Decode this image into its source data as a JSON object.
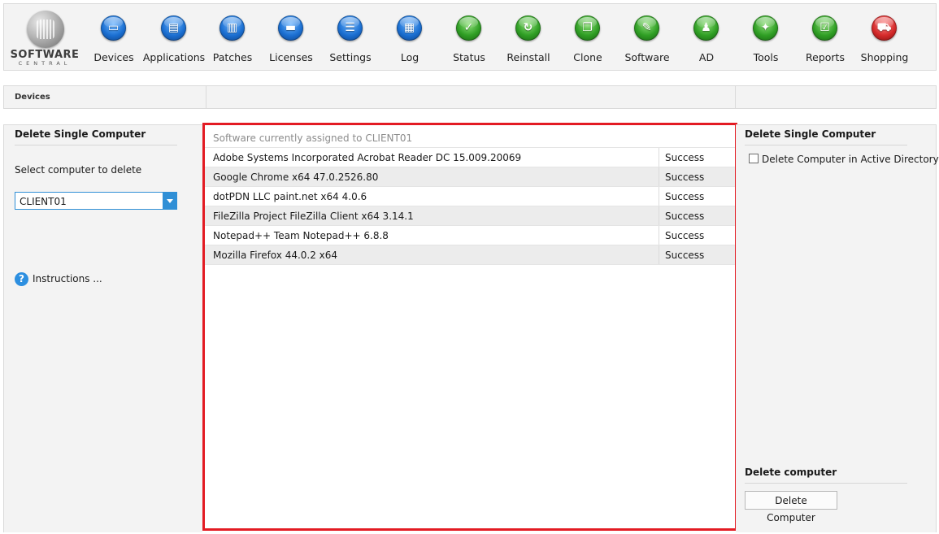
{
  "logo": {
    "word": "SOFTWARE",
    "sub": "CENTRAL"
  },
  "toolbar": {
    "items": [
      {
        "label": "Devices",
        "glyph": "▭",
        "icon": "monitor-icon",
        "color": "blue"
      },
      {
        "label": "Applications",
        "glyph": "▤",
        "icon": "applications-icon",
        "color": "blue"
      },
      {
        "label": "Patches",
        "glyph": "▥",
        "icon": "patches-icon",
        "color": "blue"
      },
      {
        "label": "Licenses",
        "glyph": "▬",
        "icon": "folder-icon",
        "color": "blue"
      },
      {
        "label": "Settings",
        "glyph": "☰",
        "icon": "settings-list-icon",
        "color": "blue"
      },
      {
        "label": "Log",
        "glyph": "▦",
        "icon": "log-book-icon",
        "color": "blue"
      },
      {
        "label": "Status",
        "glyph": "✓",
        "icon": "checkmark-icon",
        "color": "green"
      },
      {
        "label": "Reinstall",
        "glyph": "↻",
        "icon": "refresh-icon",
        "color": "green"
      },
      {
        "label": "Clone",
        "glyph": "❐",
        "icon": "clone-icon",
        "color": "green"
      },
      {
        "label": "Software",
        "glyph": "✎",
        "icon": "software-icon",
        "color": "green"
      },
      {
        "label": "AD",
        "glyph": "♟",
        "icon": "users-icon",
        "color": "green"
      },
      {
        "label": "Tools",
        "glyph": "✦",
        "icon": "wrench-icon",
        "color": "green"
      },
      {
        "label": "Reports",
        "glyph": "☑",
        "icon": "report-check-icon",
        "color": "green"
      },
      {
        "label": "Shopping",
        "glyph": "⛟",
        "icon": "shopping-cart-icon",
        "color": "red"
      }
    ]
  },
  "breadcrumb": {
    "current": "Devices"
  },
  "left_panel": {
    "title": "Delete Single Computer",
    "select_label": "Select computer to delete",
    "selected_computer": "CLIENT01",
    "instructions_label": "Instructions ..."
  },
  "main": {
    "header": "Software currently assigned to CLIENT01",
    "rows": [
      {
        "name": "Adobe Systems Incorporated Acrobat Reader DC 15.009.20069",
        "status": "Success"
      },
      {
        "name": "Google Chrome x64 47.0.2526.80",
        "status": "Success"
      },
      {
        "name": "dotPDN LLC paint.net x64 4.0.6",
        "status": "Success"
      },
      {
        "name": "FileZilla Project FileZilla Client x64 3.14.1",
        "status": "Success"
      },
      {
        "name": "Notepad++ Team Notepad++ 6.8.8",
        "status": "Success"
      },
      {
        "name": "Mozilla Firefox 44.0.2 x64",
        "status": "Success"
      }
    ]
  },
  "right_panel": {
    "title": "Delete Single Computer",
    "checkbox_label": "Delete Computer in Active Directory",
    "checkbox_checked": false,
    "section_title": "Delete computer",
    "delete_button_label": "Delete Computer"
  },
  "colors": {
    "accent": "#2f8fd6",
    "highlight_border": "#e31b23",
    "alt_row": "#ececec"
  }
}
